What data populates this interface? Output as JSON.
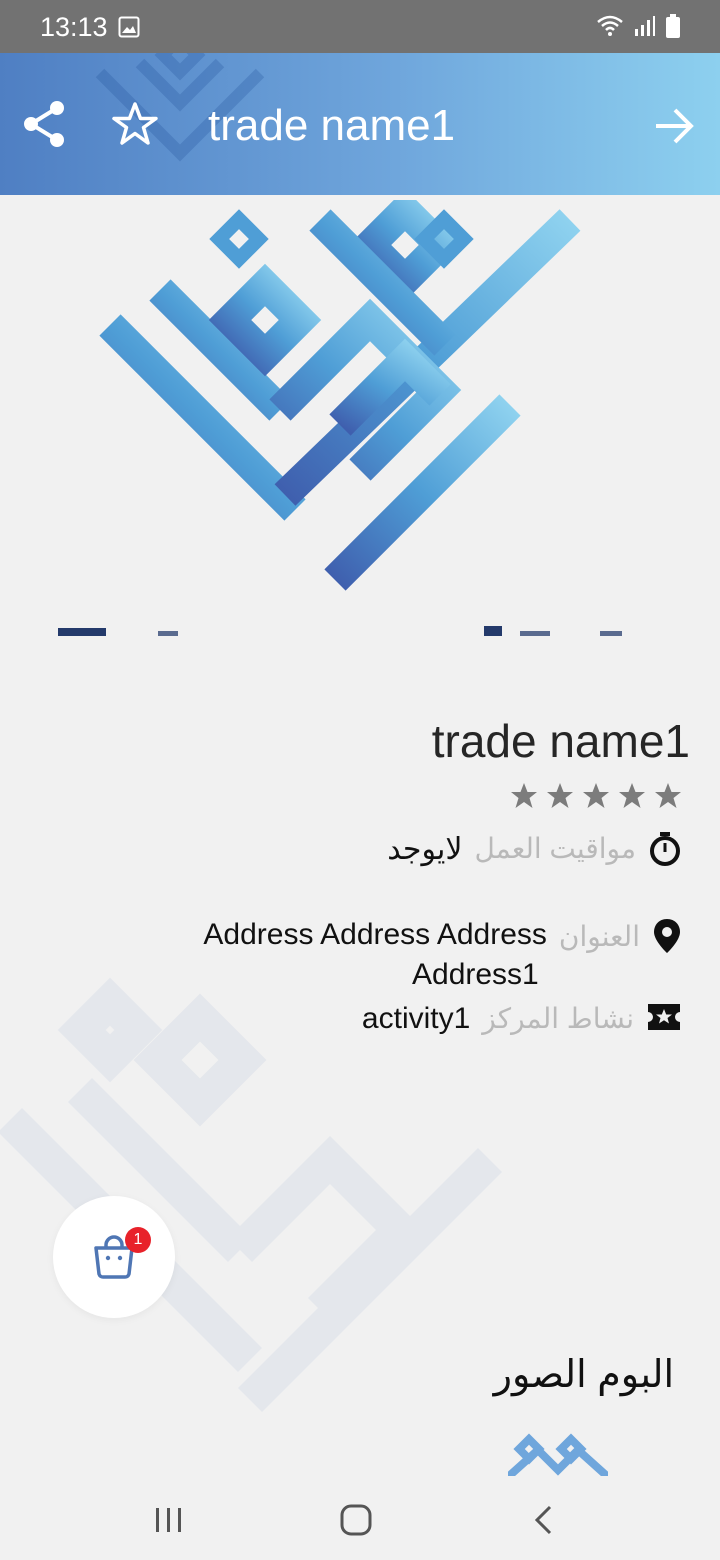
{
  "status_bar": {
    "time": "13:13"
  },
  "header": {
    "title": "trade name1"
  },
  "details": {
    "title": "trade name1",
    "rating": 0,
    "hours_label": "مواقيت العمل",
    "hours_value": "لايوجد",
    "address_label": "العنوان",
    "address_value_line1": "Address Address Address",
    "address_value_line2": "Address1",
    "activity_label": "نشاط المركز",
    "activity_value": "activity1"
  },
  "cart": {
    "count": "1"
  },
  "album": {
    "title": "البوم الصور"
  },
  "colors": {
    "header_start": "#4f7fc3",
    "header_end": "#8dd0ef",
    "star": "#7c7c7c",
    "badge": "#e8222a",
    "cart_icon": "#4f76b4"
  },
  "icons": [
    "share-icon",
    "star-outline-icon",
    "arrow-forward-icon",
    "stopwatch-icon",
    "location-pin-icon",
    "ticket-star-icon",
    "shopping-bag-icon"
  ]
}
